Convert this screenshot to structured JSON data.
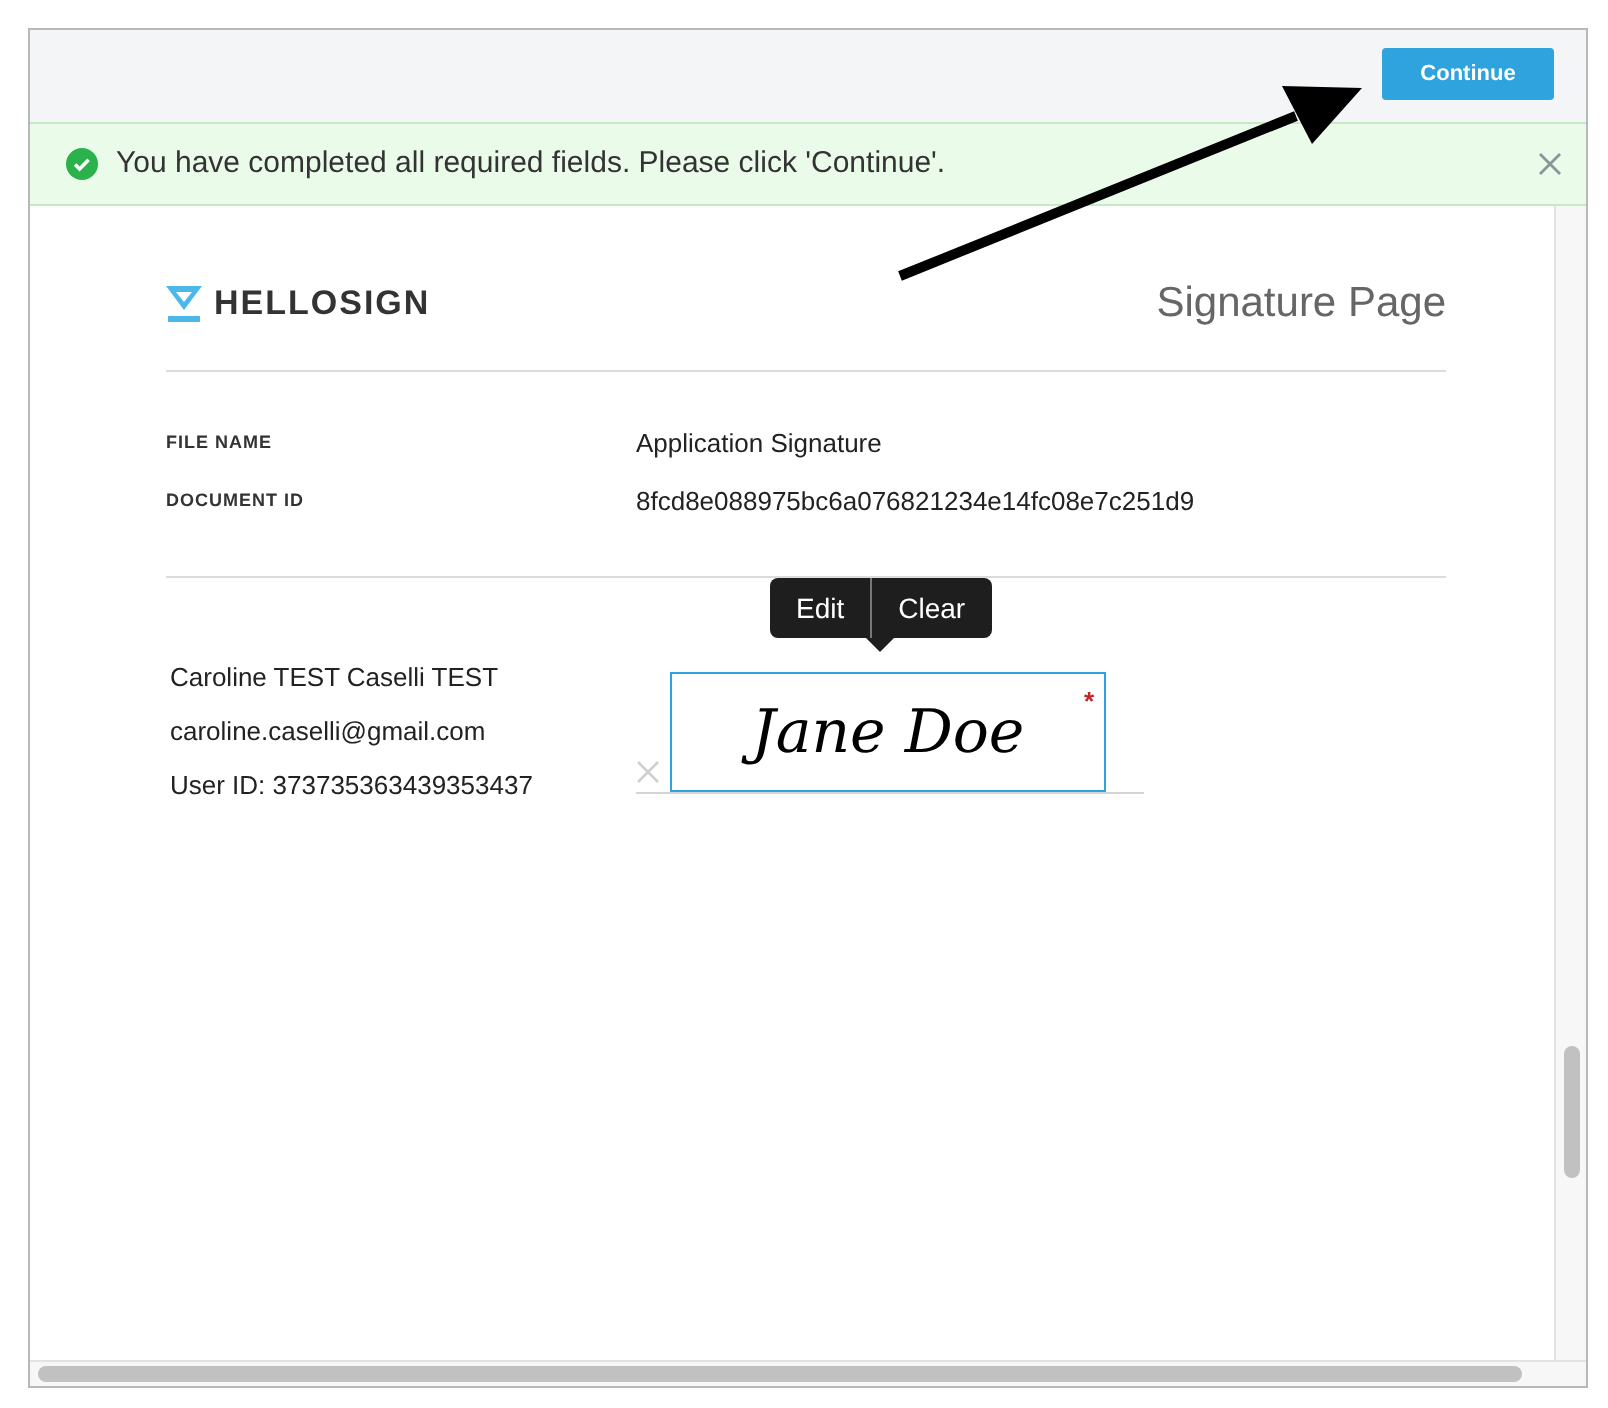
{
  "header": {
    "continue_button": "Continue"
  },
  "banner": {
    "message": "You have completed all required fields. Please click 'Continue'."
  },
  "document": {
    "logo": "HELLOSIGN",
    "title": "Signature Page",
    "fields": [
      {
        "label": "FILE NAME",
        "value": "Application Signature"
      },
      {
        "label": "DOCUMENT ID",
        "value": "8fcd8e088975bc6a076821234e14fc08e7c251d9"
      }
    ],
    "signer": [
      "Caroline TEST Caselli TEST",
      "caroline.caselli@gmail.com",
      "User ID: 373735363439353437"
    ],
    "signature": {
      "value": "Jane Doe",
      "required_mark": "*",
      "actions": [
        "Edit",
        "Clear"
      ]
    }
  }
}
